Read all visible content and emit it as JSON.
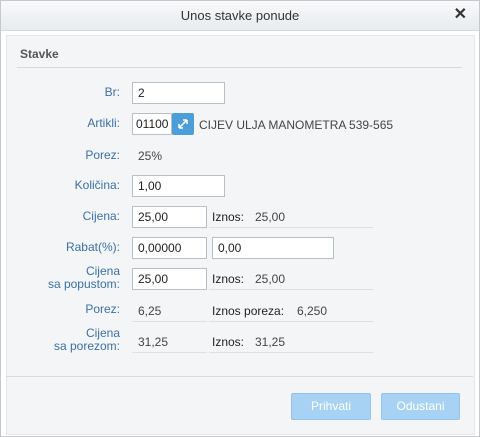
{
  "dialog": {
    "title": "Unos stavke ponude",
    "close_icon": "close-icon"
  },
  "section": {
    "title": "Stavke"
  },
  "fields": {
    "br": {
      "label": "Br:",
      "value": "2"
    },
    "artikli": {
      "label": "Artikli:",
      "code": "01100",
      "name": "CIJEV ULJA MANOMETRA 539-565",
      "picker_icon": "resize-arrows-icon"
    },
    "porez": {
      "label": "Porez:",
      "value": "25%"
    },
    "kolicina": {
      "label": "Količina:",
      "value": "1,00"
    },
    "cijena": {
      "label": "Cijena:",
      "value": "25,00",
      "iznos_label": "Iznos:",
      "iznos_value": "25,00"
    },
    "rabat": {
      "label": "Rabat(%):",
      "percent": "0,00000",
      "amount": "0,00"
    },
    "cijena_popust": {
      "label_line1": "Cijena",
      "label_line2": "sa popustom:",
      "value": "25,00",
      "iznos_label": "Iznos:",
      "iznos_value": "25,00"
    },
    "porez_iznos": {
      "label": "Porez:",
      "value": "6,25",
      "iznos_label": "Iznos poreza:",
      "iznos_value": "6,250"
    },
    "cijena_porez": {
      "label_line1": "Cijena",
      "label_line2": "sa porezom:",
      "value": "31,25",
      "iznos_label": "Iznos:",
      "iznos_value": "31,25"
    }
  },
  "buttons": {
    "accept": "Prihvati",
    "cancel": "Odustani"
  },
  "colors": {
    "label": "#3d6fa6",
    "button": "#a8d2f3",
    "picker": "#4c9ed9"
  }
}
